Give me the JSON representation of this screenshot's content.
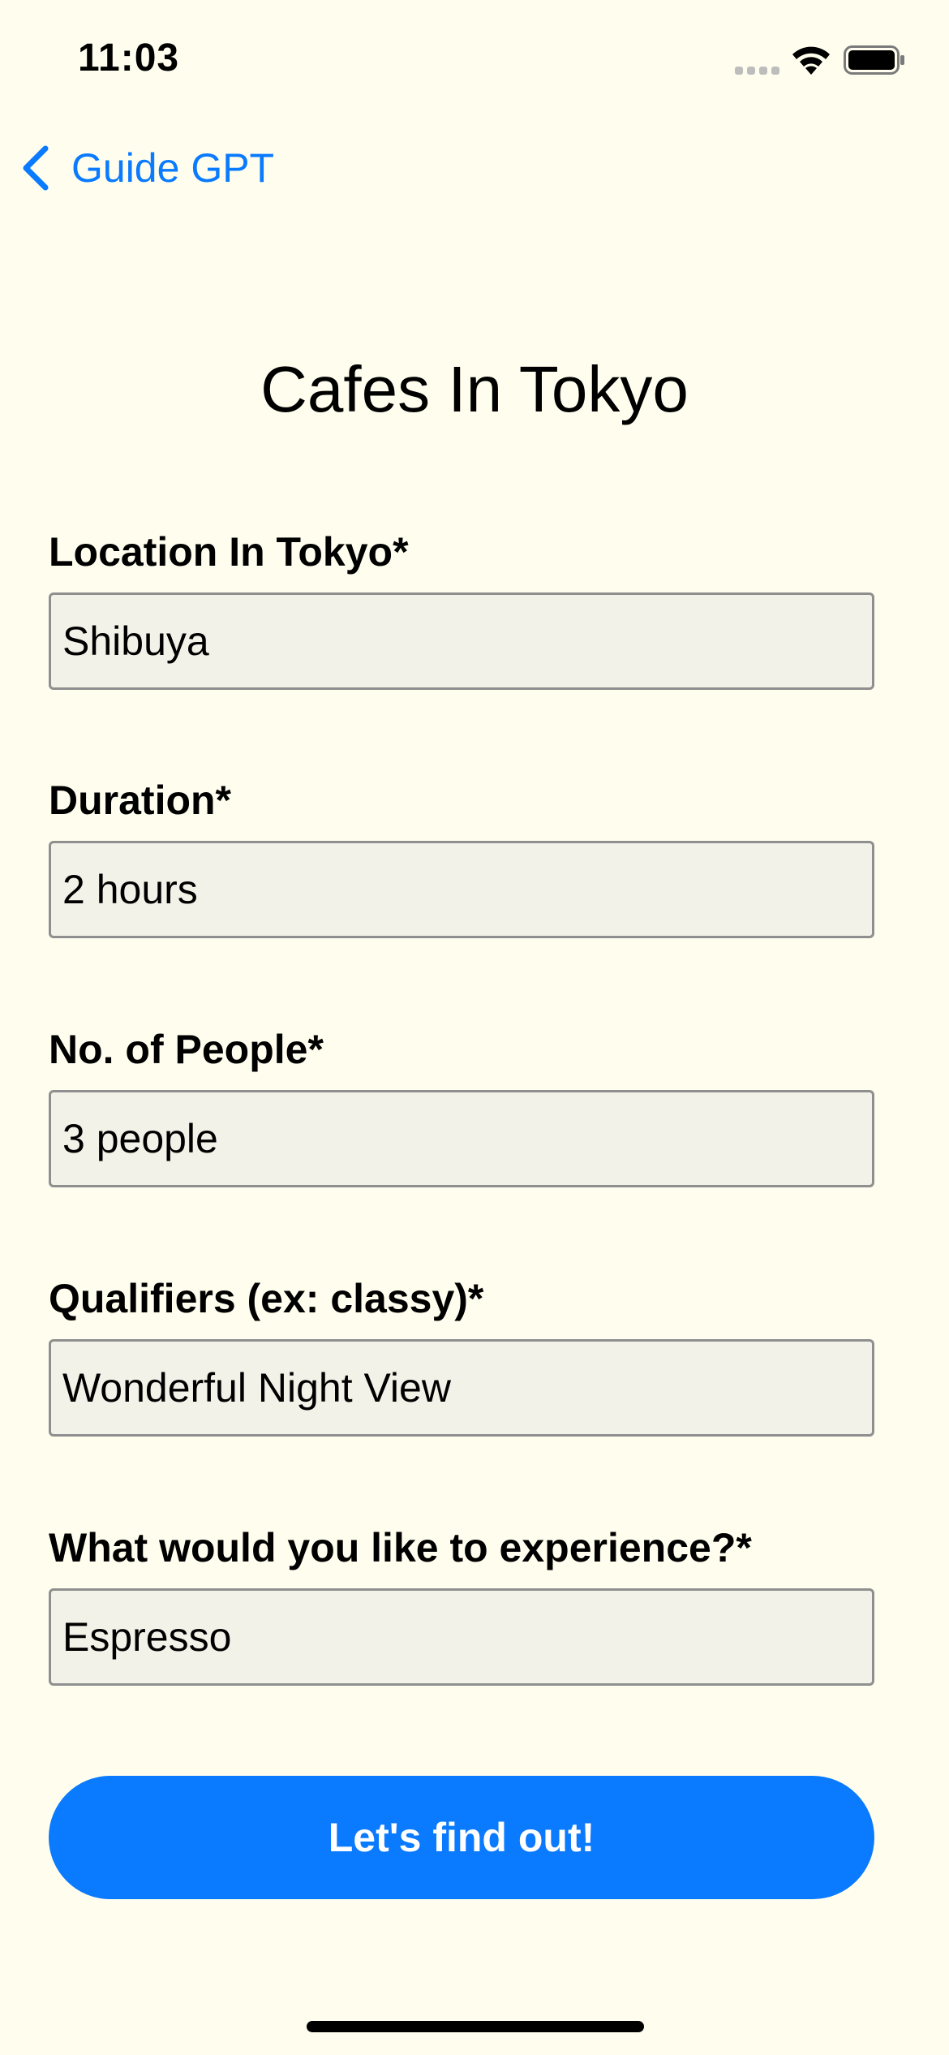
{
  "status_bar": {
    "time": "11:03",
    "icons": [
      "cellular-signal-icon",
      "wifi-icon",
      "battery-icon"
    ]
  },
  "nav": {
    "back_label": "Guide GPT",
    "back_icon": "chevron-left-icon"
  },
  "title": "Cafes In Tokyo",
  "fields": [
    {
      "label": "Location In Tokyo*",
      "value": "Shibuya"
    },
    {
      "label": "Duration*",
      "value": "2 hours"
    },
    {
      "label": "No. of People*",
      "value": "3 people"
    },
    {
      "label": "Qualifiers (ex: classy)*",
      "value": "Wonderful Night View"
    },
    {
      "label": "What would you like to experience?*",
      "value": "Espresso"
    }
  ],
  "submit_label": "Let's find out!",
  "colors": {
    "background": "#FFFEEE",
    "accent": "#0A7AFF",
    "input_background": "#F3F2E8",
    "input_border": "#8F8F8F"
  }
}
